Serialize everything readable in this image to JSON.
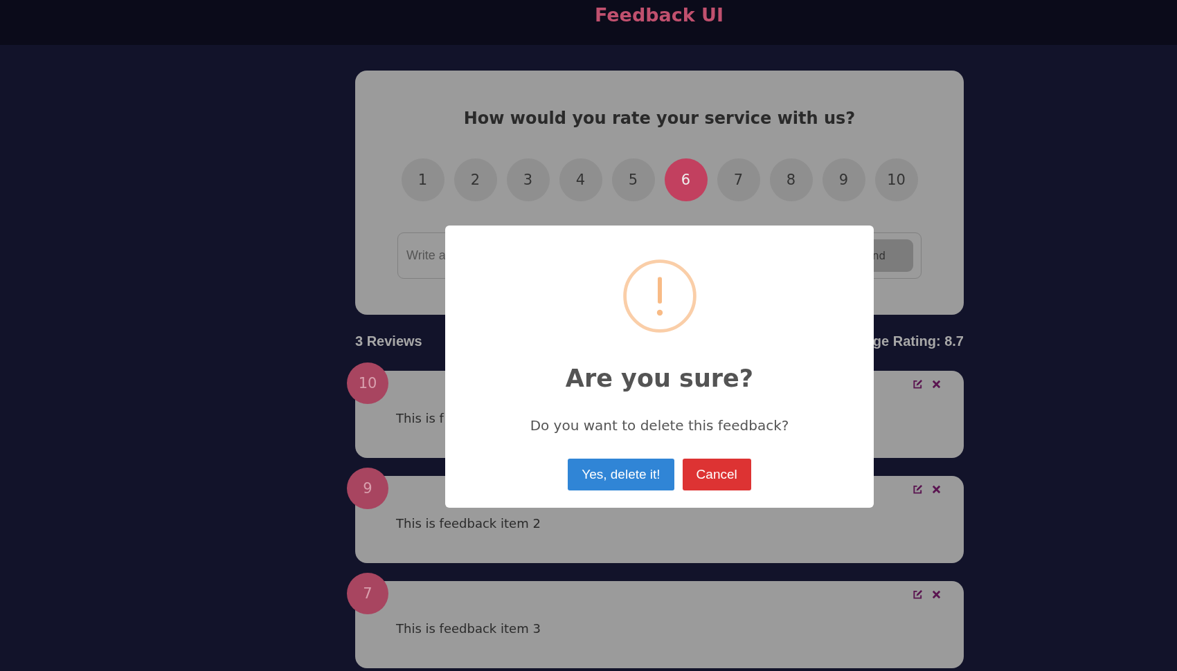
{
  "header": {
    "title": "Feedback UI"
  },
  "rating_card": {
    "question": "How would you rate your service with us?",
    "options": [
      {
        "label": "1",
        "selected": false
      },
      {
        "label": "2",
        "selected": false
      },
      {
        "label": "3",
        "selected": false
      },
      {
        "label": "4",
        "selected": false
      },
      {
        "label": "5",
        "selected": false
      },
      {
        "label": "6",
        "selected": true
      },
      {
        "label": "7",
        "selected": false
      },
      {
        "label": "8",
        "selected": false
      },
      {
        "label": "9",
        "selected": false
      },
      {
        "label": "10",
        "selected": false
      }
    ],
    "input": {
      "placeholder": "Write a"
    },
    "send_button": "nd"
  },
  "stats": {
    "count": "3 Reviews",
    "average": "ge Rating: 8.7"
  },
  "reviews": [
    {
      "rating": "10",
      "text": "This is f"
    },
    {
      "rating": "9",
      "text": "This is feedback item 2"
    },
    {
      "rating": "7",
      "text": "This is feedback item 3"
    }
  ],
  "dialog": {
    "title": "Are you sure?",
    "message": "Do you want to delete this feedback?",
    "confirm": "Yes, delete it!",
    "cancel": "Cancel"
  }
}
